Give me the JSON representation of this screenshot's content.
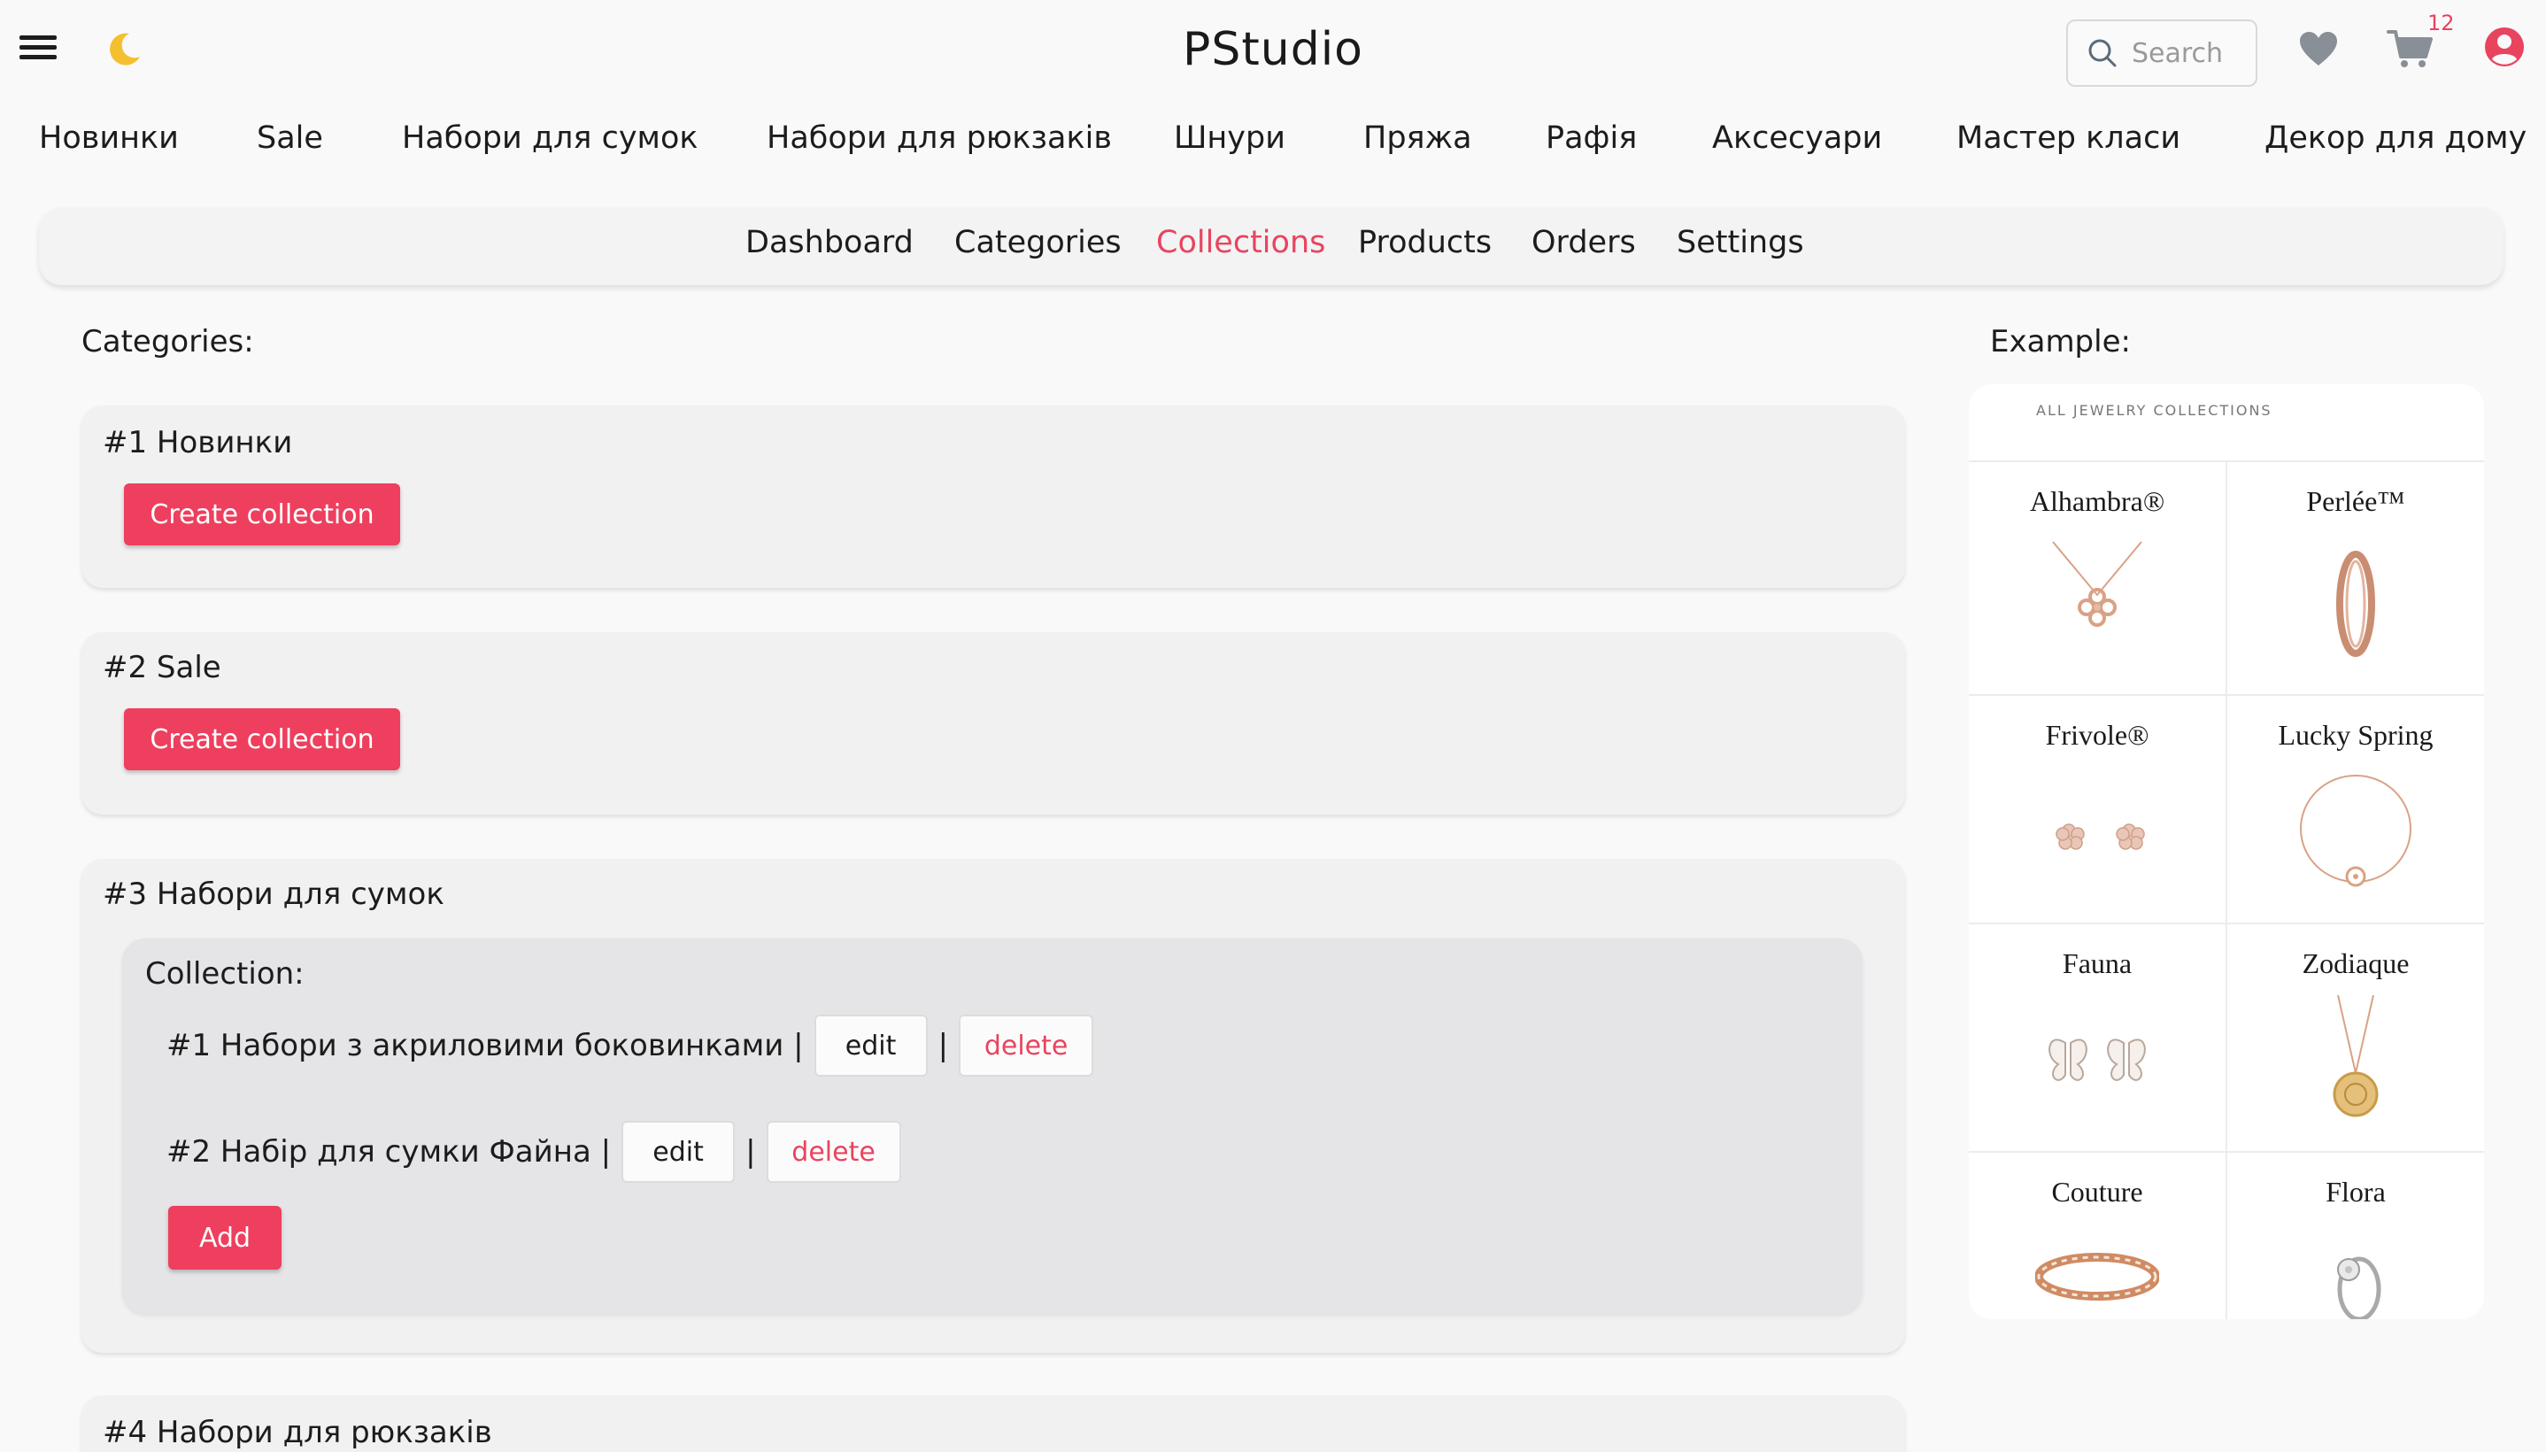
{
  "header": {
    "brand": "PStudio",
    "search_placeholder": "Search",
    "cart_count": "12"
  },
  "category_nav": [
    "Новинки",
    "Sale",
    "Набори для сумок",
    "Набори для рюкзаків",
    "Шнури",
    "Пряжа",
    "Рафія",
    "Аксесуари",
    "Мастер класи",
    "Декор для дому"
  ],
  "admin_tabs": {
    "items": [
      "Dashboard",
      "Categories",
      "Collections",
      "Products",
      "Orders",
      "Settings"
    ],
    "active": "Collections"
  },
  "main": {
    "section_title": "Categories:",
    "categories": [
      {
        "title": "#1 Новинки",
        "button": "Create collection"
      },
      {
        "title": "#2 Sale",
        "button": "Create collection"
      },
      {
        "title": "#3 Набори для сумок",
        "collection_label": "Collection:",
        "collections": [
          {
            "label": "#1 Набори з акриловими боковинками |",
            "edit": "edit",
            "sep": "|",
            "delete": "delete"
          },
          {
            "label": "#2 Набір для сумки Файна |",
            "edit": "edit",
            "sep": "|",
            "delete": "delete"
          }
        ],
        "add_button": "Add"
      },
      {
        "title": "#4 Набори для рюкзаків"
      }
    ]
  },
  "example": {
    "title": "Example:",
    "header": "ALL JEWELRY COLLECTIONS",
    "items": [
      "Alhambra®",
      "Perlée™",
      "Frivole®",
      "Lucky Spring",
      "Fauna",
      "Zodiaque",
      "Couture",
      "Flora"
    ]
  },
  "colors": {
    "accent": "#e8445e",
    "button": "#ee3f5e",
    "background": "#f9f9fa",
    "card": "#f1f1f2",
    "inner_card": "#e5e5e7",
    "moon": "#f4c02f",
    "gold_jewelry": "#d9a284"
  }
}
